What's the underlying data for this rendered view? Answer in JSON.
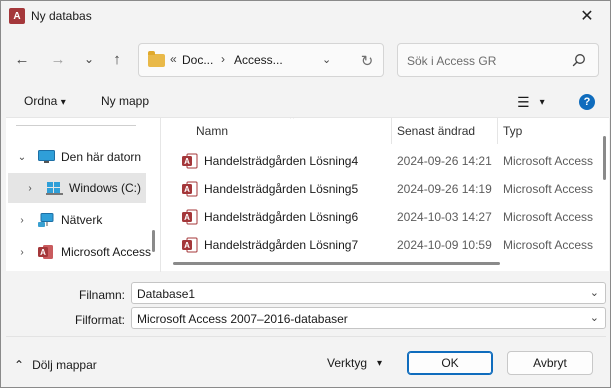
{
  "window": {
    "title": "Ny databas",
    "close_glyph": "✕",
    "app_icon_letter": "A"
  },
  "nav": {
    "back_glyph": "←",
    "forward_glyph": "→",
    "recent_glyph": "⌄",
    "up_glyph": "↑",
    "overflow_glyph": "«",
    "breadcrumbs": [
      "Doc...",
      "Access..."
    ],
    "separator_glyph": "›",
    "dropdown_glyph": "⌄",
    "refresh_glyph": "↻"
  },
  "search": {
    "placeholder": "Sök i Access GR"
  },
  "toolbar": {
    "organize_label": "Ordna",
    "organize_chevron": "▾",
    "new_folder_label": "Ny mapp",
    "view_glyph": "☰",
    "view_chevron": "▾",
    "help_glyph": "?"
  },
  "tree": {
    "items": [
      {
        "label": "Den här datorn",
        "chevron": "⌄",
        "icon": "computer-icon"
      },
      {
        "label": "Windows (C:)",
        "chevron": "›",
        "icon": "drive-icon"
      },
      {
        "label": "Nätverk",
        "chevron": "›",
        "icon": "network-icon"
      },
      {
        "label": "Microsoft Access",
        "chevron": "›",
        "icon": "access-icon"
      }
    ]
  },
  "list": {
    "columns": [
      "Namn",
      "Senast ändrad",
      "Typ"
    ],
    "sort_glyph": "⌃",
    "rows": [
      {
        "name": "Handelsträdgården Lösning4",
        "date": "2024-09-26 14:21",
        "type": "Microsoft Access"
      },
      {
        "name": "Handelsträdgården Lösning5",
        "date": "2024-09-26 14:19",
        "type": "Microsoft Access"
      },
      {
        "name": "Handelsträdgården Lösning6",
        "date": "2024-10-03 14:27",
        "type": "Microsoft Access"
      },
      {
        "name": "Handelsträdgården Lösning7",
        "date": "2024-10-09 10:59",
        "type": "Microsoft Access"
      }
    ]
  },
  "form": {
    "filename_label": "Filnamn:",
    "filename_value": "Database1",
    "format_label": "Filformat:",
    "format_value": "Microsoft Access 2007–2016-databaser",
    "dropdown_glyph": "⌄"
  },
  "footer": {
    "hide_folders_glyph": "⌃",
    "hide_folders_label": "Dölj mappar",
    "tools_label": "Verktyg",
    "tools_chevron": "▾",
    "ok_label": "OK",
    "cancel_label": "Avbryt"
  },
  "colors": {
    "accent": "#0f6cbd",
    "access_red": "#a4373a",
    "folder_yellow": "#e9b949"
  }
}
